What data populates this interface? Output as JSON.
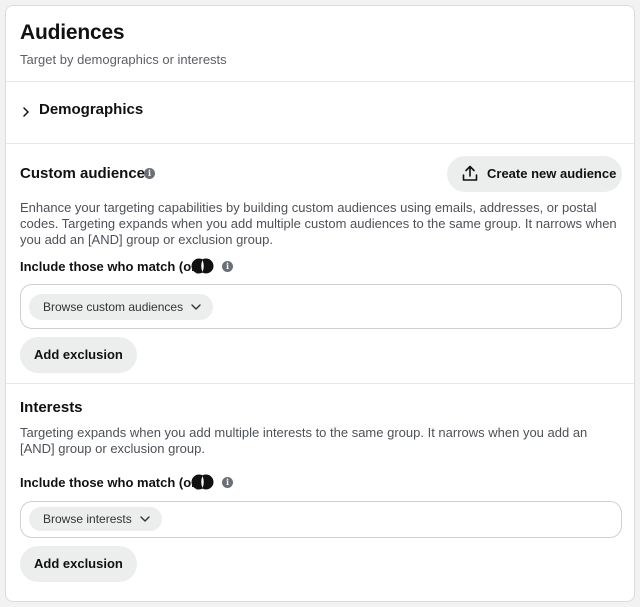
{
  "header": {
    "title": "Audiences",
    "subtitle": "Target by demographics or interests"
  },
  "demographics": {
    "label": "Demographics",
    "icon": "chevron-right-icon"
  },
  "custom_audience": {
    "title": "Custom audience",
    "create_button": "Create new audience",
    "description": "Enhance your targeting capabilities by building custom audiences using emails, addresses, or postal codes. Targeting expands when you add multiple custom audiences to the same group. It narrows when you add an [AND] group or exclusion group.",
    "include_label": "Include those who match (or)",
    "browse_chip": "Browse custom audiences",
    "add_exclusion": "Add exclusion"
  },
  "interests": {
    "title": "Interests",
    "description": "Targeting expands when you add multiple interests to the same group. It narrows when you add an [AND] group or exclusion group.",
    "include_label": "Include those who match (or)",
    "browse_chip": "Browse interests",
    "add_exclusion": "Add exclusion"
  },
  "colors": {
    "background": "#f2f2f3",
    "card": "#ffffff",
    "button": "#eceded",
    "text": "#111111",
    "muted": "#5b5f66"
  }
}
